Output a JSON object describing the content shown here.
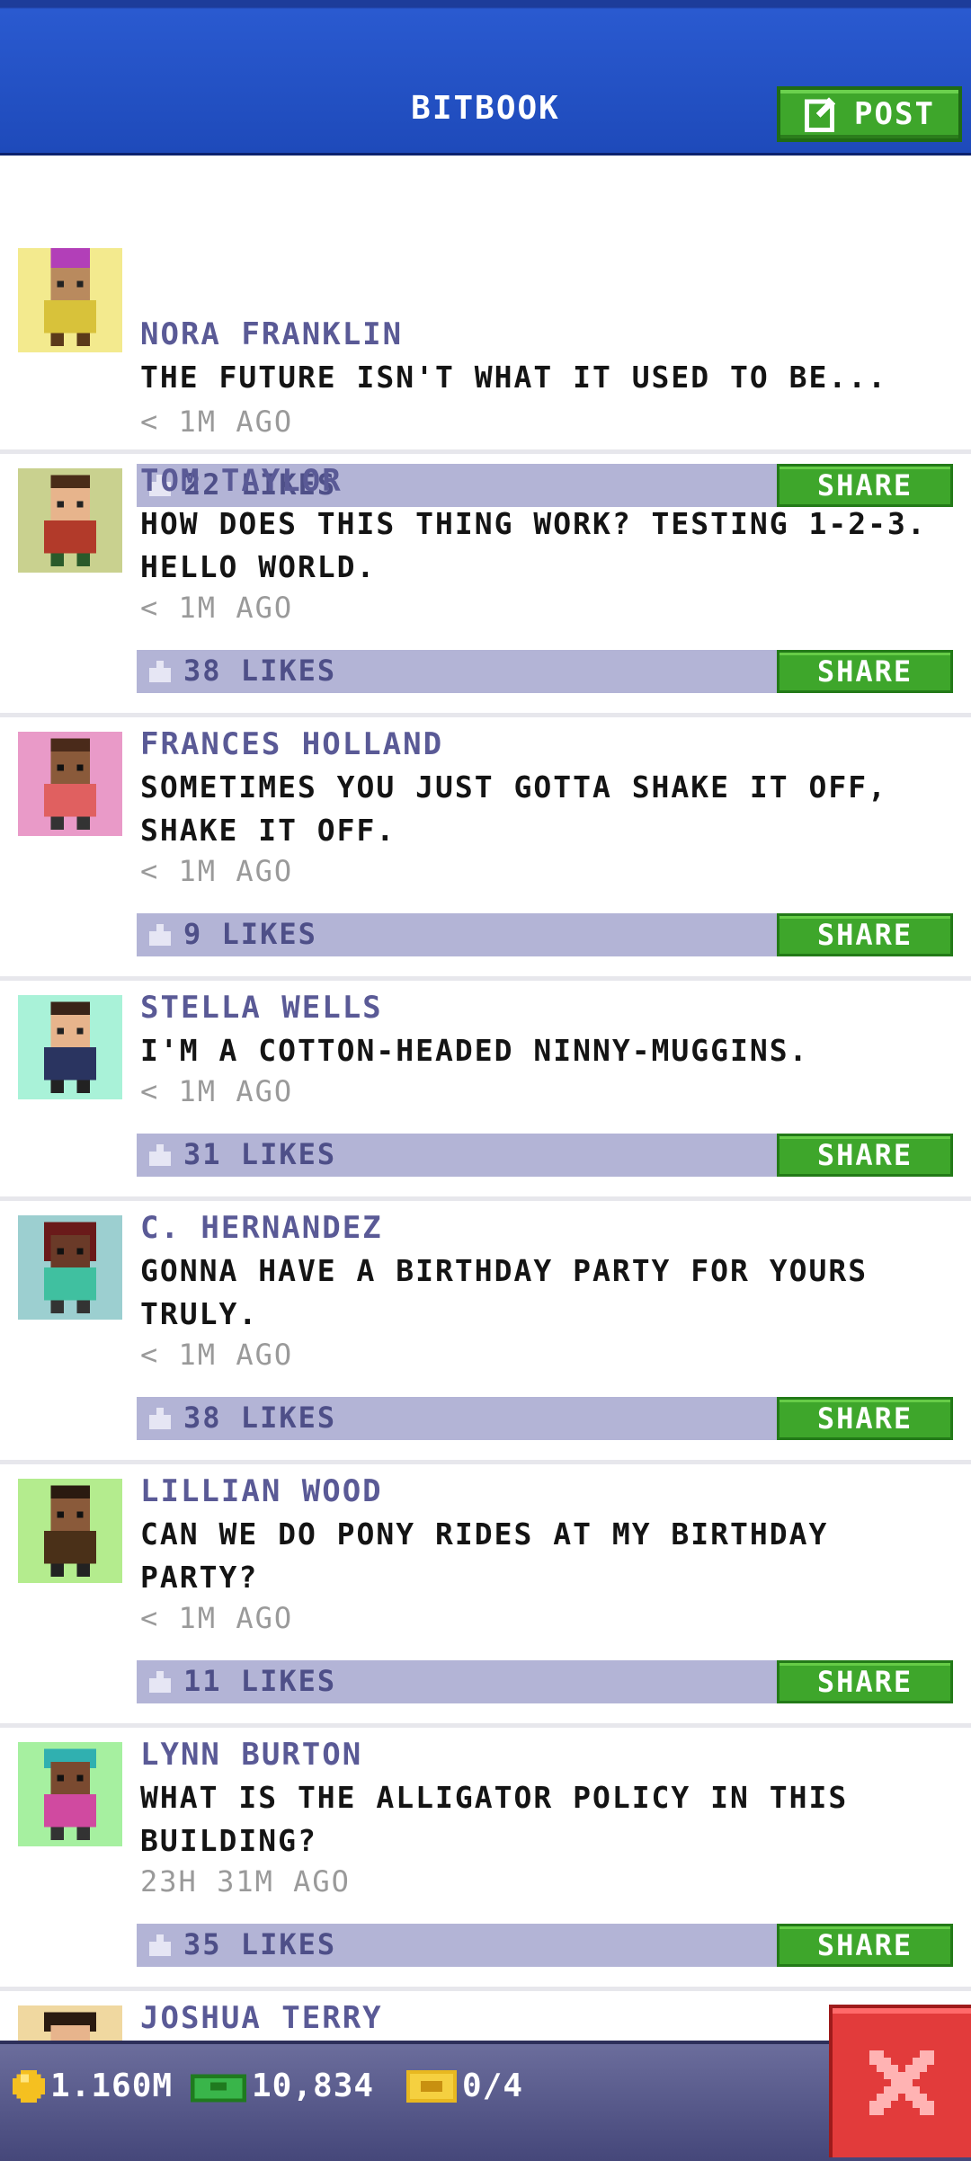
{
  "header": {
    "title": "BITBOOK",
    "post_label": "POST"
  },
  "posts": [
    {
      "name": "NORA FRANKLIN",
      "message": "THE FUTURE ISN'T WHAT IT USED TO BE...",
      "time": "< 1M AGO",
      "likes": "22 LIKES",
      "share": "SHARE",
      "avatar_bg": "#f3ea8e"
    },
    {
      "name": "TOM TAYLOR",
      "message": "HOW DOES THIS THING WORK? TESTING 1-2-3. HELLO WORLD.",
      "time": "< 1M AGO",
      "likes": "38 LIKES",
      "share": "SHARE",
      "avatar_bg": "#c9d18f"
    },
    {
      "name": "FRANCES HOLLAND",
      "message": "SOMETIMES YOU JUST GOTTA SHAKE IT OFF, SHAKE IT OFF.",
      "time": "< 1M AGO",
      "likes": "9 LIKES",
      "share": "SHARE",
      "avatar_bg": "#e99ac8"
    },
    {
      "name": "STELLA WELLS",
      "message": "I'M A COTTON-HEADED NINNY-MUGGINS.",
      "time": "< 1M AGO",
      "likes": "31 LIKES",
      "share": "SHARE",
      "avatar_bg": "#a9f2d8"
    },
    {
      "name": "C. HERNANDEZ",
      "message": "GONNA HAVE A BIRTHDAY PARTY FOR YOURS TRULY.",
      "time": "< 1M AGO",
      "likes": "38 LIKES",
      "share": "SHARE",
      "avatar_bg": "#9ccfd0"
    },
    {
      "name": "LILLIAN WOOD",
      "message": "CAN WE DO PONY RIDES AT MY BIRTHDAY PARTY?",
      "time": "< 1M AGO",
      "likes": "11 LIKES",
      "share": "SHARE",
      "avatar_bg": "#b4ec8e"
    },
    {
      "name": "LYNN BURTON",
      "message": "WHAT IS THE ALLIGATOR POLICY IN THIS BUILDING?",
      "time": "23H 31M AGO",
      "likes": "35 LIKES",
      "share": "SHARE",
      "avatar_bg": "#a6f0a0"
    },
    {
      "name": "JOSHUA TERRY",
      "avatar_bg": "#f0d8a0"
    }
  ],
  "bottom_bar": {
    "coins": "1.160M",
    "bux": "10,834",
    "tickets": "0/4"
  },
  "colors": {
    "header_blue": "#1e4aba",
    "share_green": "#3ea62b",
    "like_bar": "#b3b4d6",
    "close_red": "#e23b3b"
  },
  "icons": {
    "post": "edit-icon",
    "like": "thumb-up-icon",
    "coin": "coin-icon",
    "bux": "bux-icon",
    "ticket": "ticket-icon",
    "close": "close-icon"
  }
}
